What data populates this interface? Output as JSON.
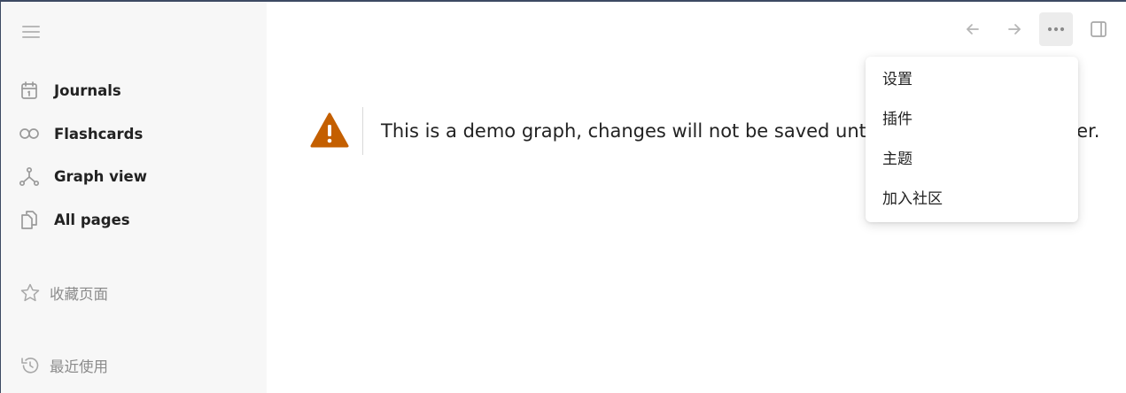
{
  "sidebar": {
    "nav": [
      {
        "label": "Journals",
        "icon": "calendar-icon"
      },
      {
        "label": "Flashcards",
        "icon": "infinity-icon"
      },
      {
        "label": "Graph view",
        "icon": "graph-icon"
      },
      {
        "label": "All pages",
        "icon": "pages-icon"
      }
    ],
    "favorites_label": "收藏页面",
    "recent_label": "最近使用"
  },
  "toolbar": {
    "back_icon": "arrow-left-icon",
    "forward_icon": "arrow-right-icon",
    "more_icon": "more-horizontal-icon",
    "sidebar_toggle_icon": "right-sidebar-icon"
  },
  "main": {
    "warning_text": "This is a demo graph, changes will not be saved until you open a local folder."
  },
  "menu": {
    "items": [
      "设置",
      "插件",
      "主题",
      "加入社区"
    ]
  },
  "colors": {
    "warning": "#c45f00",
    "sidebar_bg": "#f7f7f7",
    "icon_gray": "#9a9a9a"
  }
}
